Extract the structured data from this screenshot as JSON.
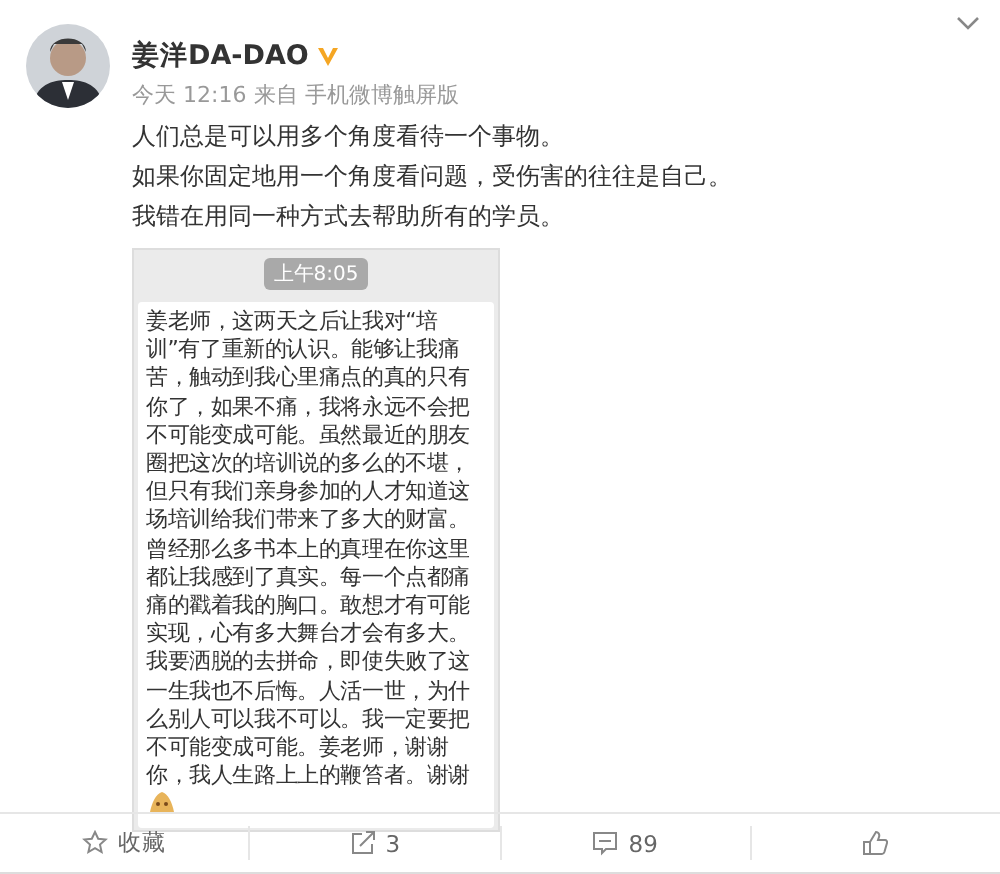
{
  "post": {
    "author": "姜洋DA-DAO",
    "verified": true,
    "time": "今天 12:16",
    "source": "来自 手机微博触屏版",
    "lines": [
      "人们总是可以用多个角度看待一个事物。",
      "如果你固定地用一个角度看问题，受伤害的往往是自己。",
      "我错在用同一种方式去帮助所有的学员。"
    ],
    "screenshot": {
      "time": "上午8:05",
      "message": "姜老师，这两天之后让我对“培训”有了重新的认识。能够让我痛苦，触动到我心里痛点的真的只有你了，如果不痛，我将永远不会把不可能变成可能。虽然最近的朋友圈把这次的培训说的多么的不堪，但只有我们亲身参加的人才知道这场培训给我们带来了多大的财富。曾经那么多书本上的真理在你这里都让我感到了真实。每一个点都痛痛的戳着我的胸口。敢想才有可能实现，心有多大舞台才会有多大。我要洒脱的去拼命，即使失败了这一生我也不后悔。人活一世，为什么别人可以我不可以。我一定要把不可能变成可能。姜老师，谢谢你，我人生路上上的鞭笞者。谢谢"
    }
  },
  "actions": [
    {
      "kind": "favorite",
      "label": "收藏"
    },
    {
      "kind": "repost",
      "label": "3"
    },
    {
      "kind": "comment",
      "label": "89"
    },
    {
      "kind": "like"
    }
  ]
}
